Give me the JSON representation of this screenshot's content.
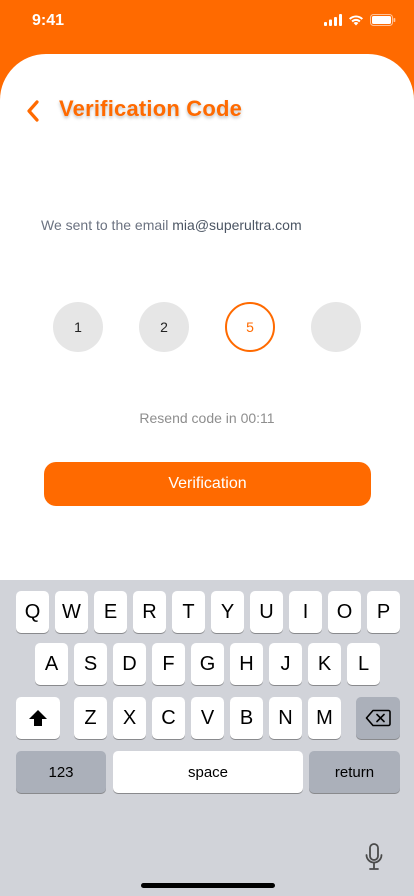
{
  "status_bar": {
    "time": "9:41"
  },
  "header": {
    "title": "Verification Code",
    "back_icon": "chevron-left-icon"
  },
  "message": {
    "prefix": "We sent to the email",
    "email": "mia@superultra.com"
  },
  "code_inputs": [
    {
      "value": "1",
      "active": false
    },
    {
      "value": "2",
      "active": false
    },
    {
      "value": "5",
      "active": true
    },
    {
      "value": "",
      "active": false
    }
  ],
  "resend": {
    "text": "Resend code in 00:11"
  },
  "verify_button": {
    "label": "Verification"
  },
  "keyboard": {
    "row1": [
      "Q",
      "W",
      "E",
      "R",
      "T",
      "Y",
      "U",
      "I",
      "O",
      "P"
    ],
    "row2": [
      "A",
      "S",
      "D",
      "F",
      "G",
      "H",
      "J",
      "K",
      "L"
    ],
    "row3": [
      "Z",
      "X",
      "C",
      "V",
      "B",
      "N",
      "M"
    ],
    "numbers_label": "123",
    "space_label": "space",
    "return_label": "return"
  },
  "colors": {
    "accent": "#ff6a00",
    "keyboard_bg": "#d1d3d9",
    "key_dark": "#abb0ba"
  }
}
